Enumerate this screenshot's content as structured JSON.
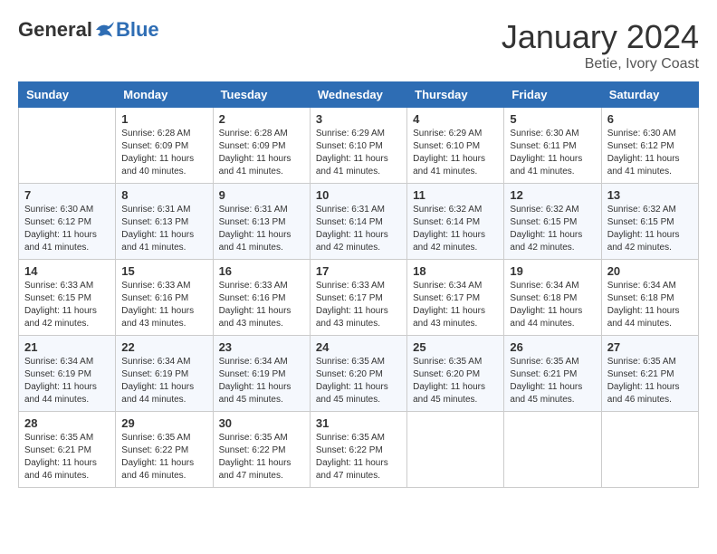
{
  "header": {
    "logo_general": "General",
    "logo_blue": "Blue",
    "month": "January 2024",
    "location": "Betie, Ivory Coast"
  },
  "days_of_week": [
    "Sunday",
    "Monday",
    "Tuesday",
    "Wednesday",
    "Thursday",
    "Friday",
    "Saturday"
  ],
  "weeks": [
    [
      {
        "day": "",
        "info": ""
      },
      {
        "day": "1",
        "info": "Sunrise: 6:28 AM\nSunset: 6:09 PM\nDaylight: 11 hours\nand 40 minutes."
      },
      {
        "day": "2",
        "info": "Sunrise: 6:28 AM\nSunset: 6:09 PM\nDaylight: 11 hours\nand 41 minutes."
      },
      {
        "day": "3",
        "info": "Sunrise: 6:29 AM\nSunset: 6:10 PM\nDaylight: 11 hours\nand 41 minutes."
      },
      {
        "day": "4",
        "info": "Sunrise: 6:29 AM\nSunset: 6:10 PM\nDaylight: 11 hours\nand 41 minutes."
      },
      {
        "day": "5",
        "info": "Sunrise: 6:30 AM\nSunset: 6:11 PM\nDaylight: 11 hours\nand 41 minutes."
      },
      {
        "day": "6",
        "info": "Sunrise: 6:30 AM\nSunset: 6:12 PM\nDaylight: 11 hours\nand 41 minutes."
      }
    ],
    [
      {
        "day": "7",
        "info": "Sunrise: 6:30 AM\nSunset: 6:12 PM\nDaylight: 11 hours\nand 41 minutes."
      },
      {
        "day": "8",
        "info": "Sunrise: 6:31 AM\nSunset: 6:13 PM\nDaylight: 11 hours\nand 41 minutes."
      },
      {
        "day": "9",
        "info": "Sunrise: 6:31 AM\nSunset: 6:13 PM\nDaylight: 11 hours\nand 41 minutes."
      },
      {
        "day": "10",
        "info": "Sunrise: 6:31 AM\nSunset: 6:14 PM\nDaylight: 11 hours\nand 42 minutes."
      },
      {
        "day": "11",
        "info": "Sunrise: 6:32 AM\nSunset: 6:14 PM\nDaylight: 11 hours\nand 42 minutes."
      },
      {
        "day": "12",
        "info": "Sunrise: 6:32 AM\nSunset: 6:15 PM\nDaylight: 11 hours\nand 42 minutes."
      },
      {
        "day": "13",
        "info": "Sunrise: 6:32 AM\nSunset: 6:15 PM\nDaylight: 11 hours\nand 42 minutes."
      }
    ],
    [
      {
        "day": "14",
        "info": "Sunrise: 6:33 AM\nSunset: 6:15 PM\nDaylight: 11 hours\nand 42 minutes."
      },
      {
        "day": "15",
        "info": "Sunrise: 6:33 AM\nSunset: 6:16 PM\nDaylight: 11 hours\nand 43 minutes."
      },
      {
        "day": "16",
        "info": "Sunrise: 6:33 AM\nSunset: 6:16 PM\nDaylight: 11 hours\nand 43 minutes."
      },
      {
        "day": "17",
        "info": "Sunrise: 6:33 AM\nSunset: 6:17 PM\nDaylight: 11 hours\nand 43 minutes."
      },
      {
        "day": "18",
        "info": "Sunrise: 6:34 AM\nSunset: 6:17 PM\nDaylight: 11 hours\nand 43 minutes."
      },
      {
        "day": "19",
        "info": "Sunrise: 6:34 AM\nSunset: 6:18 PM\nDaylight: 11 hours\nand 44 minutes."
      },
      {
        "day": "20",
        "info": "Sunrise: 6:34 AM\nSunset: 6:18 PM\nDaylight: 11 hours\nand 44 minutes."
      }
    ],
    [
      {
        "day": "21",
        "info": "Sunrise: 6:34 AM\nSunset: 6:19 PM\nDaylight: 11 hours\nand 44 minutes."
      },
      {
        "day": "22",
        "info": "Sunrise: 6:34 AM\nSunset: 6:19 PM\nDaylight: 11 hours\nand 44 minutes."
      },
      {
        "day": "23",
        "info": "Sunrise: 6:34 AM\nSunset: 6:19 PM\nDaylight: 11 hours\nand 45 minutes."
      },
      {
        "day": "24",
        "info": "Sunrise: 6:35 AM\nSunset: 6:20 PM\nDaylight: 11 hours\nand 45 minutes."
      },
      {
        "day": "25",
        "info": "Sunrise: 6:35 AM\nSunset: 6:20 PM\nDaylight: 11 hours\nand 45 minutes."
      },
      {
        "day": "26",
        "info": "Sunrise: 6:35 AM\nSunset: 6:21 PM\nDaylight: 11 hours\nand 45 minutes."
      },
      {
        "day": "27",
        "info": "Sunrise: 6:35 AM\nSunset: 6:21 PM\nDaylight: 11 hours\nand 46 minutes."
      }
    ],
    [
      {
        "day": "28",
        "info": "Sunrise: 6:35 AM\nSunset: 6:21 PM\nDaylight: 11 hours\nand 46 minutes."
      },
      {
        "day": "29",
        "info": "Sunrise: 6:35 AM\nSunset: 6:22 PM\nDaylight: 11 hours\nand 46 minutes."
      },
      {
        "day": "30",
        "info": "Sunrise: 6:35 AM\nSunset: 6:22 PM\nDaylight: 11 hours\nand 47 minutes."
      },
      {
        "day": "31",
        "info": "Sunrise: 6:35 AM\nSunset: 6:22 PM\nDaylight: 11 hours\nand 47 minutes."
      },
      {
        "day": "",
        "info": ""
      },
      {
        "day": "",
        "info": ""
      },
      {
        "day": "",
        "info": ""
      }
    ]
  ]
}
